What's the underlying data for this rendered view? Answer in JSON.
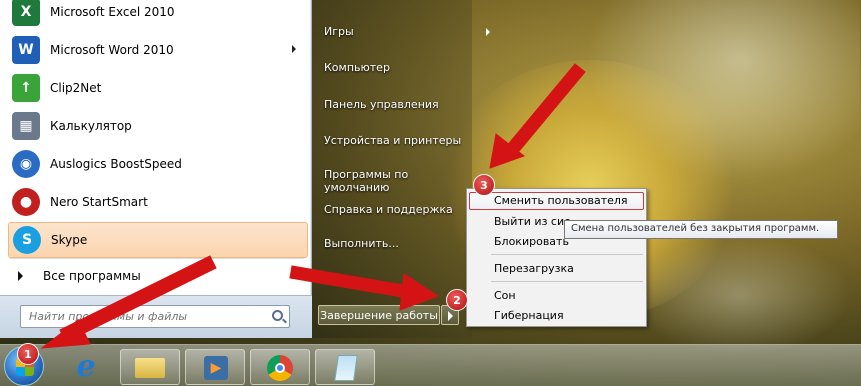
{
  "programs": [
    {
      "label": "Microsoft Excel 2010",
      "icon": "excel-icon",
      "color": "#1d7a3c",
      "glyph": "X"
    },
    {
      "label": "Microsoft Word 2010",
      "icon": "word-icon",
      "color": "#1f5fb8",
      "glyph": "W",
      "submenu": true
    },
    {
      "label": "Clip2Net",
      "icon": "clip2net-icon",
      "color": "#3aa33a",
      "glyph": "↑"
    },
    {
      "label": "Калькулятор",
      "icon": "calculator-icon",
      "color": "#6a7a8c",
      "glyph": "▦"
    },
    {
      "label": "Auslogics BoostSpeed",
      "icon": "auslogics-icon",
      "color": "#2a6bc4",
      "glyph": "◉"
    },
    {
      "label": "Nero StartSmart",
      "icon": "nero-icon",
      "color": "#c21f1f",
      "glyph": "●"
    },
    {
      "label": "Skype",
      "icon": "skype-icon",
      "color": "#1aa0e0",
      "glyph": "S"
    }
  ],
  "all_programs": "Все программы",
  "search": {
    "placeholder": "Найти программы и файлы"
  },
  "right_items": [
    {
      "label": "Игры",
      "submenu": true
    },
    {
      "label": "Компьютер"
    },
    {
      "label": "Панель управления"
    },
    {
      "label": "Устройства и принтеры"
    },
    {
      "label": "Программы по умолчанию"
    },
    {
      "label": "Справка и поддержка"
    },
    {
      "label": "Выполнить..."
    }
  ],
  "shutdown": {
    "label": "Завершение работы"
  },
  "power_menu": {
    "items": [
      "Сменить пользователя",
      "Выйти из сис",
      "Блокировать",
      "Перезагрузка",
      "Сон",
      "Гибернация"
    ]
  },
  "tooltip": "Смена пользователей без закрытия программ.",
  "badges": [
    "1",
    "2",
    "3"
  ],
  "colors": {
    "arrow": "#d41414",
    "highlight": "#fbd4ad"
  }
}
